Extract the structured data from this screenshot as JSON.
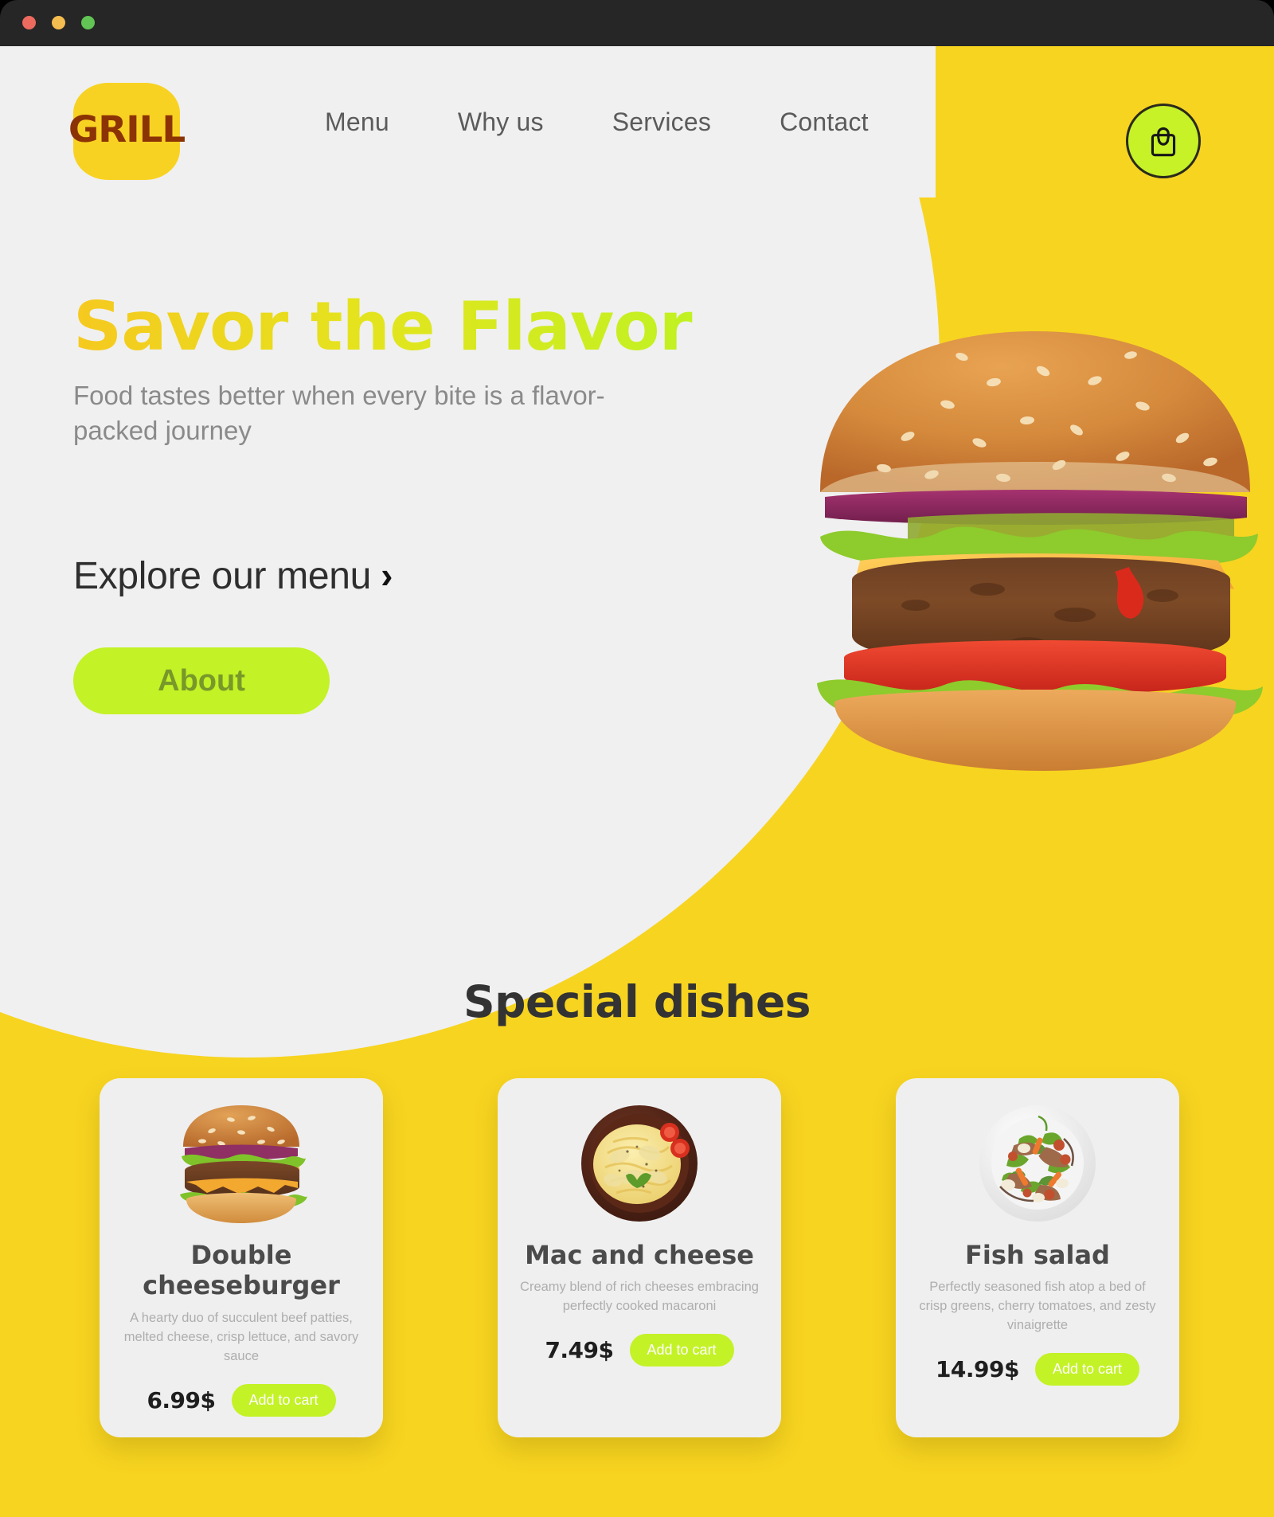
{
  "window": {
    "dots": [
      "close-red",
      "minimize-yellow",
      "maximize-green"
    ]
  },
  "brand": {
    "logo_text": "GRILL"
  },
  "nav": {
    "items": [
      {
        "label": "Menu"
      },
      {
        "label": "Why us"
      },
      {
        "label": "Services"
      },
      {
        "label": "Contact"
      }
    ],
    "cart_icon": "shopping-bag-icon"
  },
  "hero": {
    "title": "Savor the Flavor",
    "subtitle": "Food tastes better when every bite is a flavor-packed journey",
    "explore_label": "Explore our menu",
    "explore_arrow": "›",
    "about_label": "About",
    "image_alt": "cheeseburger-hero-image"
  },
  "special": {
    "heading": "Special dishes",
    "dishes": [
      {
        "name": "Double cheeseburger",
        "description": "A hearty duo of succulent beef patties, melted cheese, crisp lettuce, and savory sauce",
        "price": "6.99$",
        "button": "Add to cart",
        "image_alt": "double-cheeseburger-image"
      },
      {
        "name": "Mac and cheese",
        "description": "Creamy blend of rich cheeses embracing perfectly cooked macaroni",
        "price": "7.49$",
        "button": "Add to cart",
        "image_alt": "mac-and-cheese-image"
      },
      {
        "name": "Fish salad",
        "description": "Perfectly seasoned fish atop a bed of crisp greens, cherry tomatoes, and zesty vinaigrette",
        "price": "14.99$",
        "button": "Add to cart",
        "image_alt": "fish-salad-image"
      }
    ]
  },
  "colors": {
    "page_yellow": "#F7D420",
    "hero_light": "#F0F0F0",
    "accent_lime": "#C3F226",
    "logo_brown": "#8C3305",
    "chrome_dark": "#262626"
  }
}
